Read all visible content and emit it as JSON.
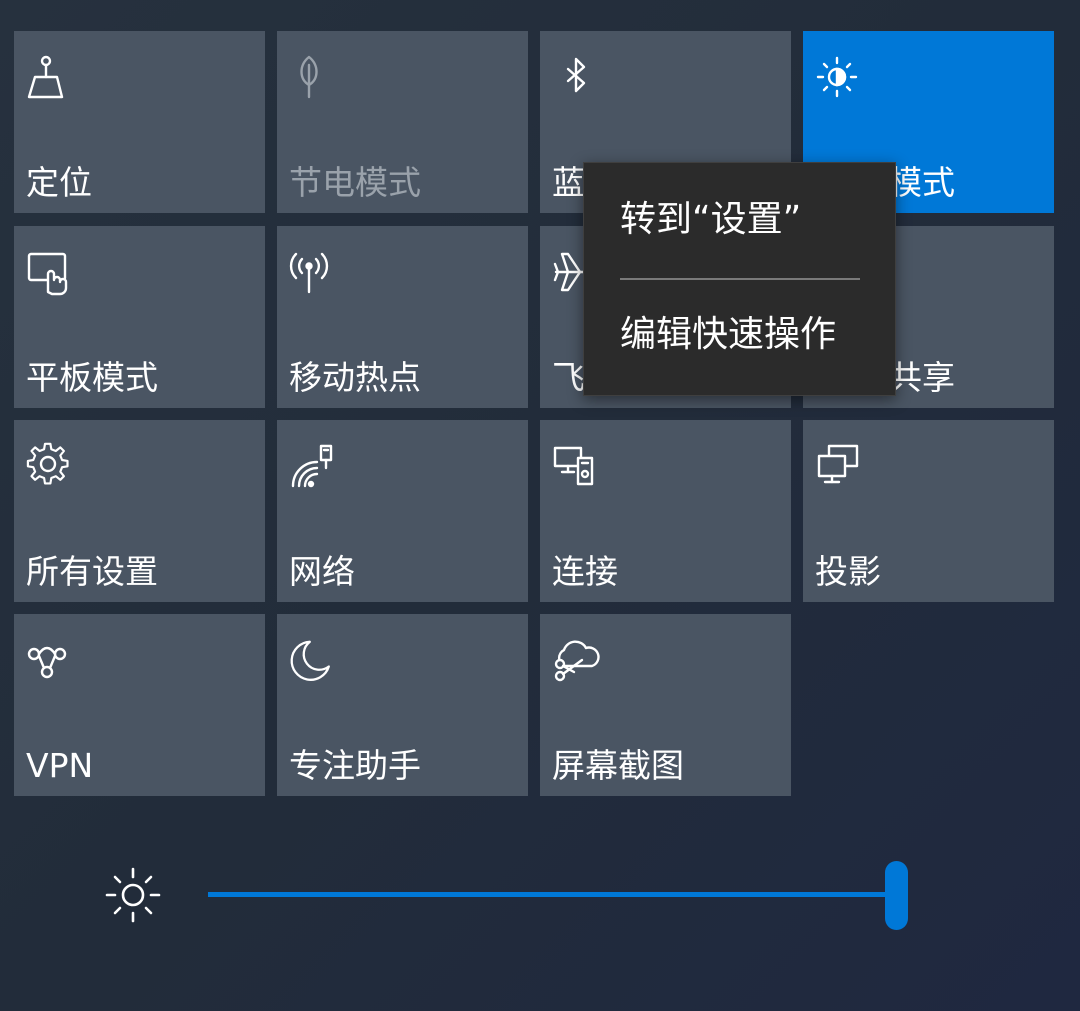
{
  "tiles": [
    {
      "label": "定位",
      "icon": "location-icon",
      "state": "normal"
    },
    {
      "label": "节电模式",
      "icon": "battery-saver-icon",
      "state": "disabled"
    },
    {
      "label": "蓝",
      "icon": "bluetooth-icon",
      "state": "normal"
    },
    {
      "label": "模式",
      "icon": "night-light-icon",
      "state": "active"
    },
    {
      "label": "平板模式",
      "icon": "tablet-mode-icon",
      "state": "normal"
    },
    {
      "label": "移动热点",
      "icon": "mobile-hotspot-icon",
      "state": "normal"
    },
    {
      "label": "飞",
      "icon": "airplane-icon",
      "state": "normal"
    },
    {
      "label": "共享",
      "icon": "nearby-share-icon",
      "state": "normal"
    },
    {
      "label": "所有设置",
      "icon": "gear-icon",
      "state": "normal"
    },
    {
      "label": "网络",
      "icon": "network-icon",
      "state": "normal"
    },
    {
      "label": "连接",
      "icon": "connect-icon",
      "state": "normal"
    },
    {
      "label": "投影",
      "icon": "project-icon",
      "state": "normal"
    },
    {
      "label": "VPN",
      "icon": "vpn-icon",
      "state": "normal"
    },
    {
      "label": "专注助手",
      "icon": "moon-icon",
      "state": "normal"
    },
    {
      "label": "屏幕截图",
      "icon": "screen-snip-icon",
      "state": "normal"
    }
  ],
  "context_menu": {
    "items": [
      "转到“设置”",
      "编辑快速操作"
    ]
  },
  "brightness": {
    "icon": "sun-icon",
    "level_percent": 100
  },
  "colors": {
    "accent": "#0078d7",
    "tile": "#4a5563",
    "menu": "#2b2b2b",
    "disabled_text": "#9aa2ab"
  }
}
